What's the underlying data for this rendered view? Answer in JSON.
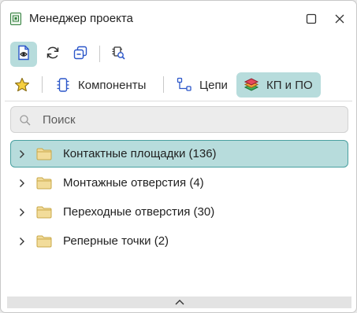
{
  "window": {
    "title": "Менеджер проекта",
    "icons": {
      "app": "pcb-project-icon",
      "maximize": "maximize-icon",
      "close": "close-icon"
    }
  },
  "toolbar": {
    "buttons": [
      {
        "name": "view-document-button",
        "icon": "document-eye-icon",
        "active": true
      },
      {
        "name": "refresh-button",
        "icon": "refresh-icon",
        "active": false
      },
      {
        "name": "collapse-all-button",
        "icon": "collapse-all-icon",
        "active": false
      },
      {
        "name": "find-component-button",
        "icon": "chip-search-icon",
        "active": false
      }
    ]
  },
  "tabs": {
    "favorites_icon": "star-icon",
    "items": [
      {
        "label": "Компоненты",
        "icon": "component-icon",
        "active": false
      },
      {
        "label": "Цепи",
        "icon": "net-icon",
        "active": false
      },
      {
        "label": "КП и ПО",
        "icon": "layers-icon",
        "active": true
      }
    ]
  },
  "search": {
    "placeholder": "Поиск",
    "value": "",
    "icon": "search-icon"
  },
  "tree": {
    "items": [
      {
        "label": "Контактные площадки (136)",
        "selected": true
      },
      {
        "label": "Монтажные отверстия (4)",
        "selected": false
      },
      {
        "label": "Переходные отверстия (30)",
        "selected": false
      },
      {
        "label": "Реперные точки (2)",
        "selected": false
      }
    ]
  },
  "footer": {
    "icon": "chevron-up-icon"
  },
  "colors": {
    "accent": "#b7dcdc",
    "accent_border": "#4aa0a0",
    "folder": "#f2dc9a",
    "folder_stroke": "#c9a94a"
  }
}
